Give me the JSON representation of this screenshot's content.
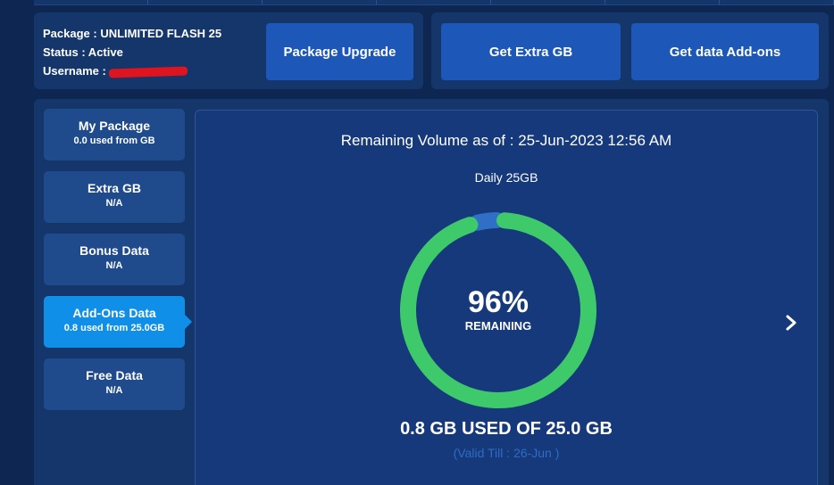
{
  "package_info": {
    "package_line": "Package : UNLIMITED FLASH 25",
    "status_line": "Status : Active",
    "username_prefix": "Username : "
  },
  "actions": {
    "package_upgrade": "Package Upgrade",
    "get_extra_gb": "Get Extra GB",
    "get_data_addons": "Get data Add-ons"
  },
  "tabs": [
    {
      "title": "My Package",
      "subtitle": "0.0 used from GB"
    },
    {
      "title": "Extra GB",
      "subtitle": "N/A"
    },
    {
      "title": "Bonus Data",
      "subtitle": "N/A"
    },
    {
      "title": "Add-Ons Data",
      "subtitle": "0.8 used from 25.0GB",
      "active": true
    },
    {
      "title": "Free Data",
      "subtitle": "N/A"
    }
  ],
  "usage_card": {
    "as_of": "Remaining Volume as of : 25-Jun-2023 12:56 AM",
    "plan": "Daily 25GB",
    "percent_text": "96%",
    "percent_label": "REMAINING",
    "remaining_fraction": 0.96,
    "usage_text": "0.8 GB USED OF 25.0 GB",
    "valid_till": "(Valid Till : 26-Jun )"
  },
  "colors": {
    "gauge_remaining": "#3ec96a",
    "gauge_used": "#2f6fc6",
    "active_tab": "#0f8fe8",
    "button": "#1d57b8"
  },
  "icons": {
    "next": "chevron-right-icon"
  }
}
